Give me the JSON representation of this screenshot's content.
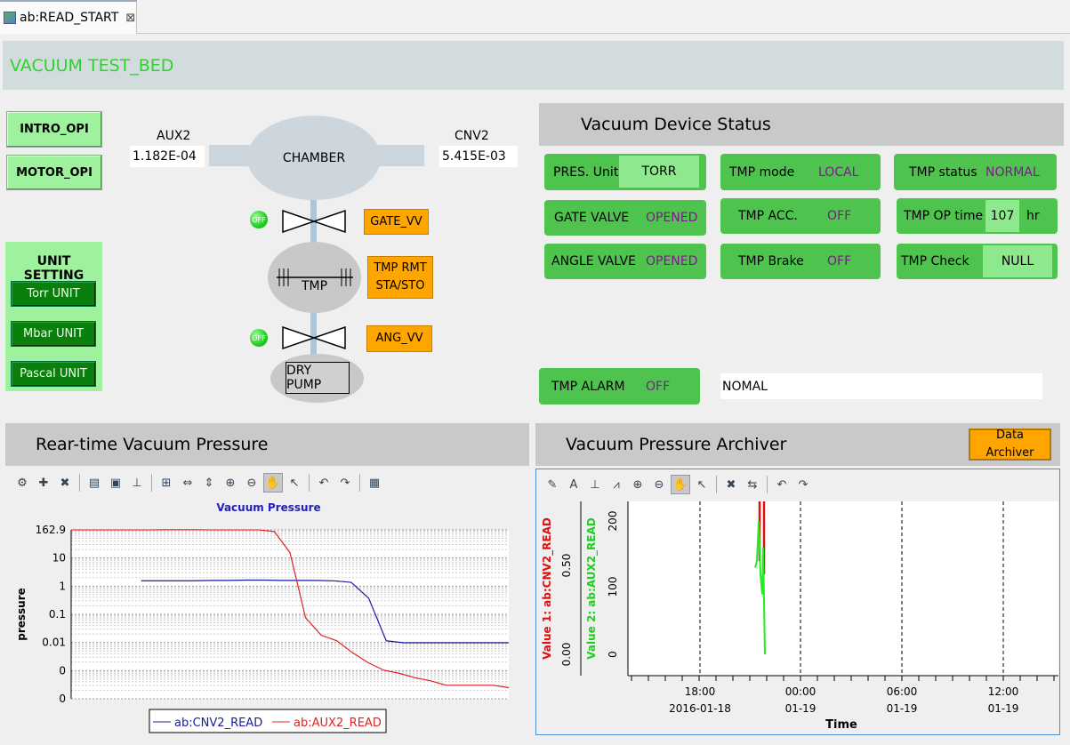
{
  "tab": {
    "title": "ab:READ_START",
    "close": "⊠"
  },
  "header": {
    "title": "VACUUM TEST_BED"
  },
  "nav": {
    "intro": "INTRO_OPI",
    "motor": "MOTOR_OPI"
  },
  "unit_setting": {
    "title": "UNIT SETTING",
    "torr": "Torr UNIT",
    "mbar": "Mbar UNIT",
    "pascal": "Pascal UNIT"
  },
  "diagram": {
    "aux2_label": "AUX2",
    "aux2_value": "1.182E-04",
    "cnv2_label": "CNV2",
    "cnv2_value": "5.415E-03",
    "chamber": "CHAMBER",
    "tmp": "TMP",
    "dry_pump": "DRY PUMP",
    "gate_vv": "GATE_VV",
    "tmp_rmt": "TMP RMT",
    "tmp_sta": "STA/STO",
    "ang_vv": "ANG_VV",
    "led_text": "OFF"
  },
  "status": {
    "title": "Vacuum Device Status",
    "pres_unit_label": "PRES. Unit",
    "pres_unit_value": "TORR",
    "tmp_mode_label": "TMP mode",
    "tmp_mode_value": "LOCAL",
    "tmp_status_label": "TMP status",
    "tmp_status_value": "NORMAL",
    "gate_label": "GATE VALVE",
    "gate_value": "OPENED",
    "tmp_acc_label": "TMP ACC.",
    "tmp_acc_value": "OFF",
    "tmp_op_label": "TMP OP time",
    "tmp_op_value": "107",
    "tmp_op_unit": "hr",
    "angle_label": "ANGLE VALVE",
    "angle_value": "OPENED",
    "tmp_brake_label": "TMP Brake",
    "tmp_brake_value": "OFF",
    "tmp_check_label": "TMP Check",
    "tmp_check_value": "NULL",
    "alarm_label": "TMP ALARM",
    "alarm_value": "OFF",
    "alarm_msg": "NOMAL"
  },
  "realtime": {
    "title": "Rear-time Vacuum Pressure"
  },
  "archiver": {
    "title": "Vacuum Pressure Archiver",
    "button": "Data Archiver"
  },
  "colors": {
    "green_btn": "#9ef29e",
    "status_green": "#4ec44e",
    "value_purple": "#7a1b8a",
    "orange": "#ffa500",
    "header_green": "#2bd42b"
  },
  "chart_data": [
    {
      "type": "line",
      "title": "Vacuum Pressure",
      "ylabel": "pressure",
      "xlabel": "",
      "y_ticks": [
        "162.9",
        "10",
        "1",
        "0.1",
        "0.01",
        "0",
        "0"
      ],
      "log_scale": true,
      "grid": true,
      "legend_position": "bottom",
      "series": [
        {
          "name": "ab:CNV2_READ",
          "color": "#1a1a9e",
          "values": [
            1.5,
            1.5,
            1.5,
            1.5,
            1.55,
            1.55,
            1.6,
            1.6,
            1.55,
            1.55,
            1.55,
            1.5,
            1.3,
            0.3,
            0.006,
            0.005,
            0.005,
            0.005,
            0.005,
            0.005,
            0.005,
            0.005
          ]
        },
        {
          "name": "ab:AUX2_READ",
          "color": "#e02020",
          "values": [
            162,
            162,
            162,
            162,
            162,
            162,
            165,
            165,
            165,
            162,
            162,
            162,
            162,
            140,
            20,
            0.05,
            0.01,
            0.006,
            0.002,
            0.0008,
            0.0004,
            0.0003,
            0.0002,
            0.00015,
            0.0001,
            0.0001,
            0.0001,
            0.0001,
            8e-05
          ]
        }
      ]
    },
    {
      "type": "line",
      "title": "",
      "y1_label": "Value 1: ab:CNV2_READ",
      "y2_label": "Value 2: ab:AUX2_READ",
      "y1_ticks": [
        "0.00",
        "0.50"
      ],
      "y2_ticks": [
        "0",
        "100",
        "200"
      ],
      "xlabel": "Time",
      "x_ticks": [
        {
          "time": "18:00",
          "date": "2016-01-18"
        },
        {
          "time": "00:00",
          "date": "01-19"
        },
        {
          "time": "06:00",
          "date": "01-19"
        },
        {
          "time": "12:00",
          "date": "01-19"
        }
      ],
      "series": [
        {
          "name": "ab:CNV2_READ",
          "color": "#dd1111",
          "values": [
            0.55,
            0.45,
            0.0
          ]
        },
        {
          "name": "ab:AUX2_READ",
          "color": "#22ee22",
          "values": [
            130,
            140,
            200,
            120,
            90,
            160,
            0
          ]
        }
      ]
    }
  ]
}
